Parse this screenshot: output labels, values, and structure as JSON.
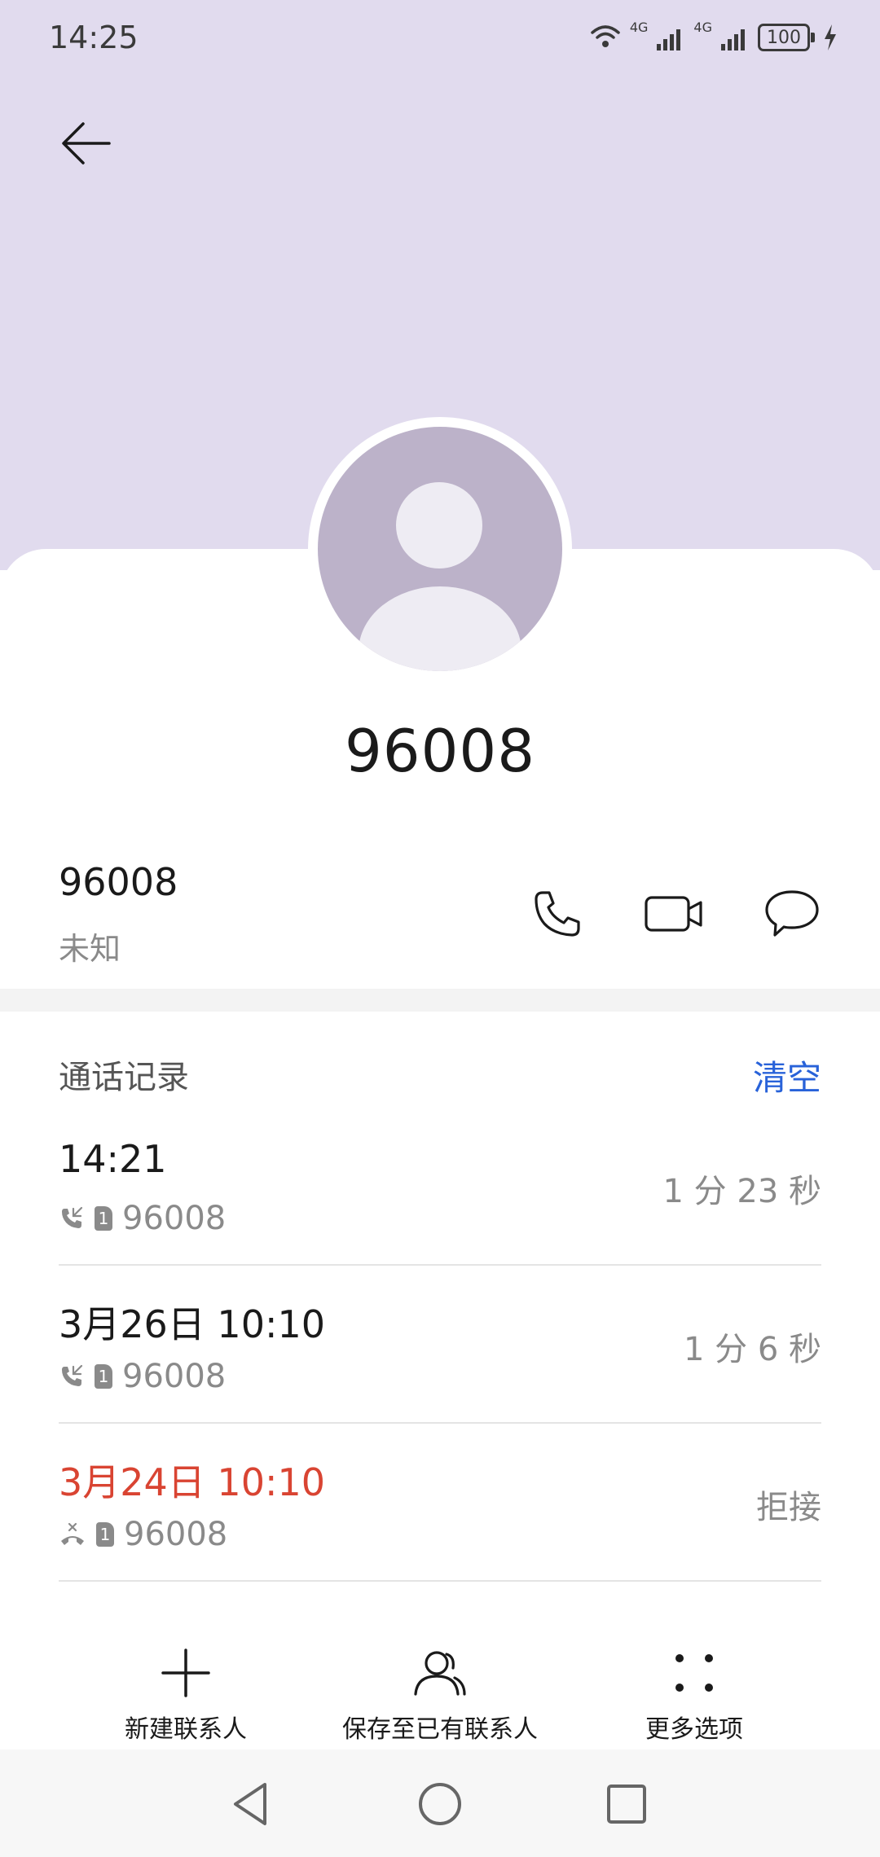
{
  "status_bar": {
    "time": "14:25",
    "network_1": "4G",
    "network_2": "4G",
    "battery": "100",
    "icons": [
      "wifi-icon",
      "signal-icon",
      "signal-icon",
      "battery-icon",
      "charging-icon"
    ]
  },
  "header": {
    "back_icon": "back-arrow-icon",
    "title": "96008"
  },
  "contact": {
    "number": "96008",
    "label": "未知",
    "actions": [
      {
        "name": "call-button",
        "icon": "phone-icon"
      },
      {
        "name": "video-call-button",
        "icon": "video-camera-icon"
      },
      {
        "name": "message-button",
        "icon": "chat-bubble-icon"
      }
    ]
  },
  "call_log": {
    "title": "通话记录",
    "clear_label": "清空",
    "entries": [
      {
        "time": "14:21",
        "number": "96008",
        "sim": "1",
        "duration": "1 分 23 秒",
        "type": "incoming",
        "icon": "incoming-call-icon"
      },
      {
        "time": "3月26日 10:10",
        "number": "96008",
        "sim": "1",
        "duration": "1 分 6 秒",
        "type": "incoming",
        "icon": "incoming-call-icon"
      },
      {
        "time": "3月24日 10:10",
        "number": "96008",
        "sim": "1",
        "duration": "拒接",
        "type": "rejected",
        "icon": "rejected-call-icon"
      }
    ]
  },
  "bottom_actions": {
    "new_contact": "新建联系人",
    "save_to_existing": "保存至已有联系人",
    "more_options": "更多选项"
  },
  "colors": {
    "header_bg": "#e1dbee",
    "accent": "#2862d9",
    "missed": "#d94432",
    "avatar": "#bcb2c9"
  }
}
